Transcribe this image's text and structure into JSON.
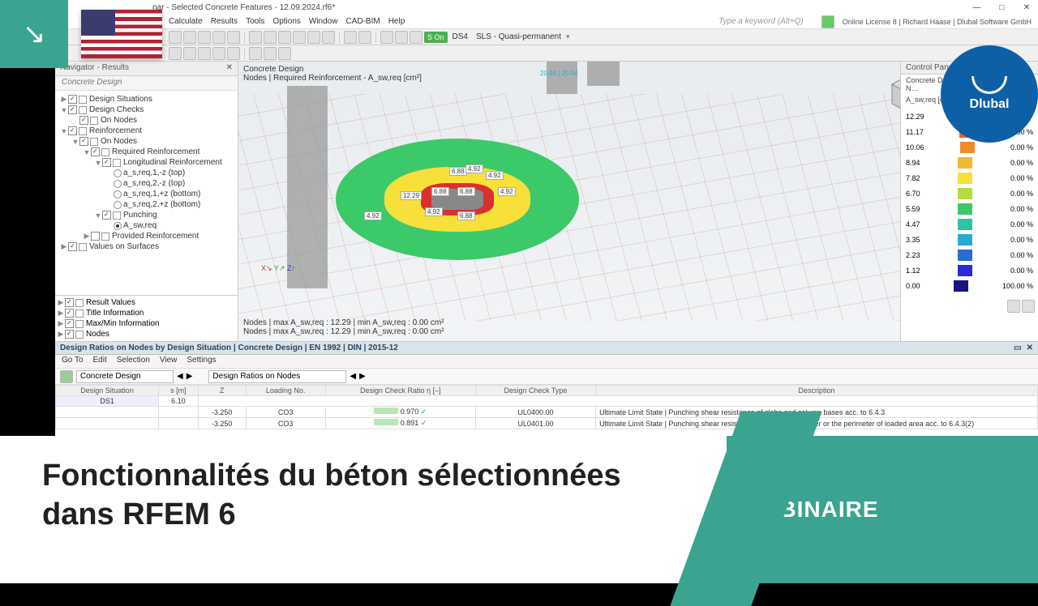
{
  "title": "nar - Selected Concrete Features - 12.09.2024.rf6*",
  "menu": [
    "Calculate",
    "Results",
    "Tools",
    "Options",
    "Window",
    "CAD-BIM",
    "Help"
  ],
  "search_placeholder": "Type a keyword (Alt+Q)",
  "license": "Online License 8 | Richard Haase | Dlubal Software GmbH",
  "toolbar1": {
    "ds_badge": "S On",
    "ds_label": "DS4",
    "sls_label": "SLS - Quasi-permanent"
  },
  "navigator": {
    "title": "Navigator - Results",
    "header": "Concrete Design",
    "tree": [
      {
        "t": "item",
        "lv": 0,
        "chk": true,
        "label": "Design Situations",
        "toggle": "▶"
      },
      {
        "t": "item",
        "lv": 0,
        "chk": true,
        "label": "Design Checks",
        "toggle": "▼"
      },
      {
        "t": "item",
        "lv": 1,
        "chk": true,
        "label": "On Nodes",
        "toggle": ""
      },
      {
        "t": "item",
        "lv": 0,
        "chk": true,
        "label": "Reinforcement",
        "toggle": "▼"
      },
      {
        "t": "item",
        "lv": 1,
        "chk": true,
        "label": "On Nodes",
        "toggle": "▼"
      },
      {
        "t": "item",
        "lv": 2,
        "chk": true,
        "label": "Required Reinforcement",
        "toggle": "▼"
      },
      {
        "t": "item",
        "lv": 3,
        "chk": true,
        "label": "Longitudinal Reinforcement",
        "toggle": "▼"
      },
      {
        "t": "radio",
        "lv": 4,
        "sel": false,
        "label": "a_s,req,1,-z (top)"
      },
      {
        "t": "radio",
        "lv": 4,
        "sel": false,
        "label": "a_s,req,2,-z (top)"
      },
      {
        "t": "radio",
        "lv": 4,
        "sel": false,
        "label": "a_s,req,1,+z (bottom)"
      },
      {
        "t": "radio",
        "lv": 4,
        "sel": false,
        "label": "a_s,req,2,+z (bottom)"
      },
      {
        "t": "item",
        "lv": 3,
        "chk": true,
        "label": "Punching",
        "toggle": "▼"
      },
      {
        "t": "radio",
        "lv": 4,
        "sel": true,
        "label": "A_sw,req"
      },
      {
        "t": "item",
        "lv": 2,
        "chk": false,
        "label": "Provided Reinforcement",
        "toggle": "▶"
      },
      {
        "t": "item",
        "lv": 0,
        "chk": true,
        "label": "Values on Surfaces",
        "toggle": "▶"
      }
    ],
    "bottom_items": [
      "Result Values",
      "Title Information",
      "Max/Min Information",
      "Nodes"
    ]
  },
  "viewport": {
    "header_line1": "Concrete Design",
    "header_line2": "Nodes | Required Reinforcement - A_sw,req [cm²]",
    "top_label": "20.94 | 20.94",
    "labels_a": [
      "6.88",
      "4.92",
      "4.92",
      "6.88",
      "12.29",
      "6.88",
      "4.92",
      "4.92",
      "6.88",
      "4.92"
    ],
    "stats_line1": "Nodes | max A_sw,req : 12.29 | min A_sw,req : 0.00 cm²",
    "stats_line2": "Nodes | max A_sw,req : 12.29 | min A_sw,req : 0.00 cm²"
  },
  "control_panel": {
    "title": "Control Panel",
    "subtitle": "Concrete Design | Reinforcement by N…",
    "unit": "A_sw,req [cm²]",
    "legend": [
      {
        "v": "12.29",
        "c": "#d9302e",
        "p": ""
      },
      {
        "v": "11.17",
        "c": "#e85b2c",
        "p": "0.00 %"
      },
      {
        "v": "10.06",
        "c": "#ef8a2d",
        "p": "0.00 %"
      },
      {
        "v": "8.94",
        "c": "#f4b731",
        "p": "0.00 %"
      },
      {
        "v": "7.82",
        "c": "#f7e03a",
        "p": "0.00 %"
      },
      {
        "v": "6.70",
        "c": "#b4dc3b",
        "p": "0.00 %"
      },
      {
        "v": "5.59",
        "c": "#3cc96a",
        "p": "0.00 %"
      },
      {
        "v": "4.47",
        "c": "#2bc4a5",
        "p": "0.00 %"
      },
      {
        "v": "3.35",
        "c": "#2aa9d6",
        "p": "0.00 %"
      },
      {
        "v": "2.23",
        "c": "#2a6cd6",
        "p": "0.00 %"
      },
      {
        "v": "1.12",
        "c": "#2a2ad6",
        "p": "0.00 %"
      },
      {
        "v": "0.00",
        "c": "#161680",
        "p": "100.00 %"
      }
    ]
  },
  "bottom": {
    "title": "Design Ratios on Nodes by Design Situation | Concrete Design | EN 1992 | DIN | 2015-12",
    "menu": [
      "Go To",
      "Edit",
      "Selection",
      "View",
      "Settings"
    ],
    "select_left": "Concrete Design",
    "select_right": "Design Ratios on Nodes",
    "headers": [
      "Design Situation",
      "s [m]",
      "Z",
      "Loading No.",
      "Design Check Ratio η [–]",
      "Design Check Type",
      "Description"
    ],
    "ds_row": {
      "ds": "DS1",
      "s": "6.10"
    },
    "rows": [
      {
        "z": "-3.250",
        "load": "CO3",
        "ratio": "0.970",
        "chk": "✓",
        "type": "UL0400.00",
        "desc": "Ultimate Limit State | Punching shear resistance of slabs and column bases acc. to 6.4.3"
      },
      {
        "z": "-3.250",
        "load": "CO3",
        "ratio": "0.891",
        "chk": "✓",
        "type": "UL0401.00",
        "desc": "Ultimate Limit State | Punching shear resistance at column perimeter or the perimeter of loaded area acc. to 6.4.3(2)"
      }
    ]
  },
  "banner": {
    "title_l1": "Fonctionnalités du béton sélectionnées",
    "title_l2": "dans RFEM 6",
    "label": "WEBINAIRE"
  },
  "dlubal": "Dlubal",
  "chart_data": {
    "type": "contour-plot",
    "title": "Concrete Design — Nodes | Required Reinforcement A_sw,req",
    "unit": "cm²",
    "value_range": [
      0.0,
      12.29
    ],
    "colormap_stops": [
      {
        "value": 12.29,
        "color": "#d9302e"
      },
      {
        "value": 11.17,
        "color": "#e85b2c"
      },
      {
        "value": 10.06,
        "color": "#ef8a2d"
      },
      {
        "value": 8.94,
        "color": "#f4b731"
      },
      {
        "value": 7.82,
        "color": "#f7e03a"
      },
      {
        "value": 6.7,
        "color": "#b4dc3b"
      },
      {
        "value": 5.59,
        "color": "#3cc96a"
      },
      {
        "value": 4.47,
        "color": "#2bc4a5"
      },
      {
        "value": 3.35,
        "color": "#2aa9d6"
      },
      {
        "value": 2.23,
        "color": "#2a6cd6"
      },
      {
        "value": 1.12,
        "color": "#2a2ad6"
      },
      {
        "value": 0.0,
        "color": "#161680"
      }
    ],
    "nodal_values_labeled": [
      12.29,
      6.88,
      6.88,
      6.88,
      6.88,
      4.92,
      4.92,
      4.92,
      4.92,
      4.92,
      4.92
    ],
    "remote_node_label": 20.94,
    "stats": {
      "max": 12.29,
      "min": 0.0
    }
  }
}
